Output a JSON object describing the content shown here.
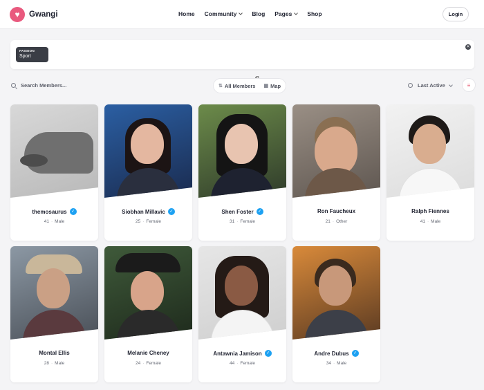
{
  "header": {
    "brand": "Gwangi",
    "nav": [
      {
        "label": "Home",
        "dropdown": false
      },
      {
        "label": "Community",
        "dropdown": true
      },
      {
        "label": "Blog",
        "dropdown": false
      },
      {
        "label": "Pages",
        "dropdown": true
      },
      {
        "label": "Shop",
        "dropdown": false
      }
    ],
    "login_label": "Login"
  },
  "filter": {
    "chip_label": "PASSION",
    "chip_value": "Sport"
  },
  "toolbar": {
    "search_placeholder": "Search Members...",
    "all_members_label": "All Members",
    "map_label": "Map",
    "member_count": "43",
    "sort_label": "Last Active"
  },
  "colors": {
    "brand": "#e9597e",
    "verified": "#1da1f2"
  },
  "members": [
    {
      "name": "themosaurus",
      "age": "41",
      "gender": "Male",
      "verified": true
    },
    {
      "name": "Siobhan Millavic",
      "age": "25",
      "gender": "Female",
      "verified": true
    },
    {
      "name": "Shen Foster",
      "age": "31",
      "gender": "Female",
      "verified": true
    },
    {
      "name": "Ron Faucheux",
      "age": "21",
      "gender": "Other",
      "verified": false
    },
    {
      "name": "Ralph Fiennes",
      "age": "41",
      "gender": "Male",
      "verified": false
    },
    {
      "name": "Montal Ellis",
      "age": "28",
      "gender": "Male",
      "verified": false
    },
    {
      "name": "Melanie Cheney",
      "age": "24",
      "gender": "Female",
      "verified": false
    },
    {
      "name": "Antawnia Jamison",
      "age": "44",
      "gender": "Female",
      "verified": true
    },
    {
      "name": "Andre Dubus",
      "age": "34",
      "gender": "Male",
      "verified": true
    }
  ]
}
